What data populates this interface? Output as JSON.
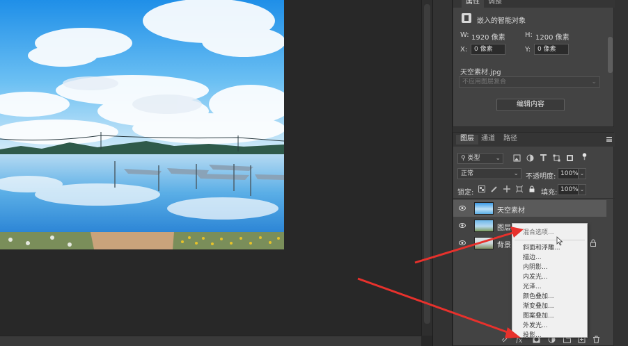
{
  "properties": {
    "tabs": [
      "属性",
      "调整"
    ],
    "embedded_type": "嵌入的智能对象",
    "w_label": "W:",
    "w_value": "1920 像素",
    "h_label": "H:",
    "h_value": "1200 像素",
    "x_label": "X:",
    "x_value": "0 像素",
    "y_label": "Y:",
    "y_value": "0 像素",
    "filename": "天空素材.jpg",
    "layer_comp_placeholder": "不应用图层复合",
    "edit_button": "编辑内容"
  },
  "layers": {
    "tabs": [
      "图层",
      "通道",
      "路径"
    ],
    "filter_kind": "类型",
    "blend_mode": "正常",
    "opacity_label": "不透明度:",
    "opacity_value": "100%",
    "lock_label": "锁定:",
    "fill_label": "填充:",
    "fill_value": "100%",
    "items": [
      {
        "name": "天空素材"
      },
      {
        "name": "图层 1"
      },
      {
        "name": "背景"
      }
    ]
  },
  "context_menu": {
    "items": [
      "混合选项...",
      "斜面和浮雕...",
      "描边...",
      "内阴影...",
      "内发光...",
      "光泽...",
      "颜色叠加...",
      "渐变叠加...",
      "图案叠加...",
      "外发光...",
      "投影..."
    ]
  },
  "colors": {
    "arrow": "#e8312c",
    "panel_bg": "#434343",
    "app_bg": "#282828",
    "menu_bg": "#f0f0f0"
  }
}
